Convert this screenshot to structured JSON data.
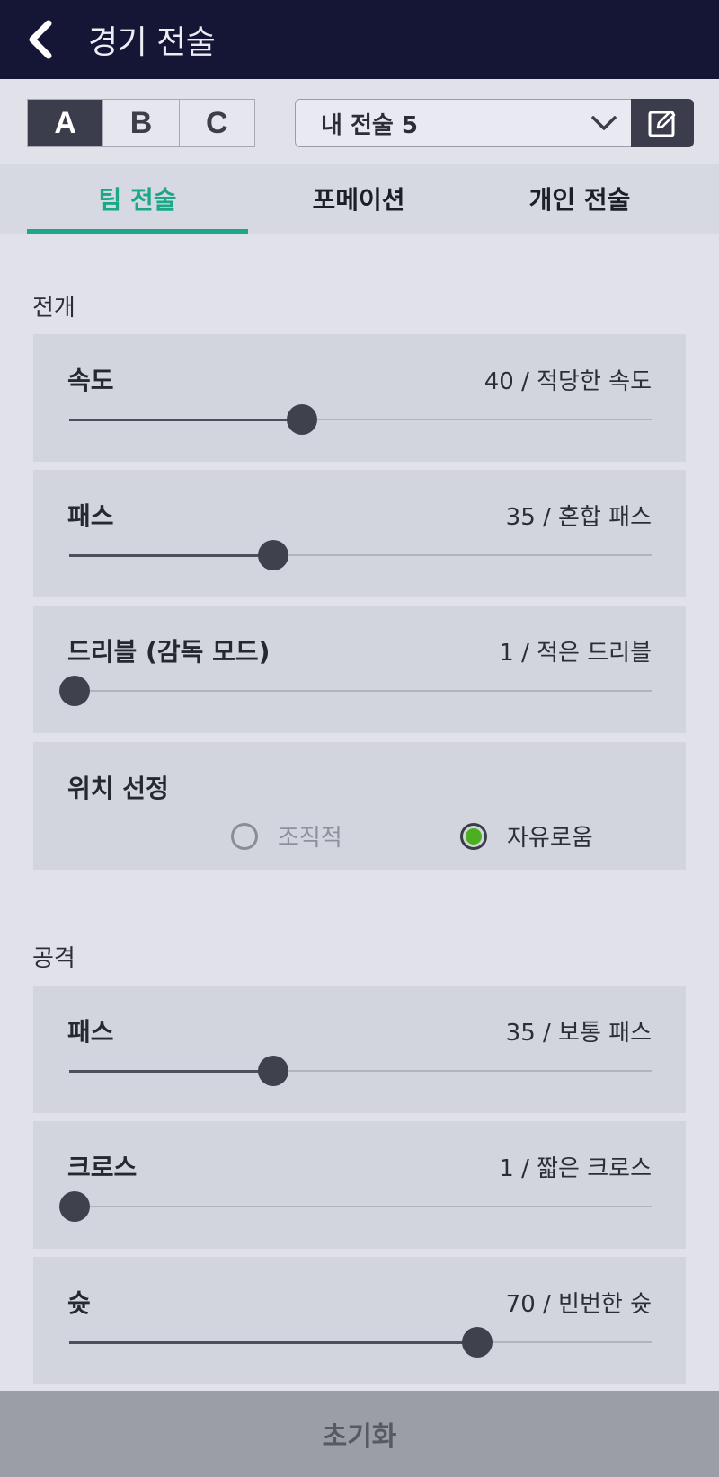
{
  "header": {
    "title": "경기 전술"
  },
  "preset_selector": {
    "segments": [
      "A",
      "B",
      "C"
    ],
    "active_segment": "A",
    "preset_name": "내 전술 5"
  },
  "tabs": [
    {
      "label": "팀 전술",
      "active": true
    },
    {
      "label": "포메이션",
      "active": false
    },
    {
      "label": "개인 전술",
      "active": false
    }
  ],
  "sections": {
    "buildup": {
      "title": "전개",
      "speed": {
        "label": "속도",
        "value_text": "40 / 적당한 속도",
        "value": 40
      },
      "passing": {
        "label": "패스",
        "value_text": "35 / 혼합 패스",
        "value": 35
      },
      "dribbling": {
        "label": "드리블 (감독 모드)",
        "value_text": "1 / 적은 드리블",
        "value": 1
      },
      "positioning": {
        "label": "위치 선정",
        "options": [
          "조직적",
          "자유로움"
        ],
        "selected": "자유로움"
      }
    },
    "attack": {
      "title": "공격",
      "passing": {
        "label": "패스",
        "value_text": "35 / 보통 패스",
        "value": 35
      },
      "crossing": {
        "label": "크로스",
        "value_text": "1 / 짧은 크로스",
        "value": 1
      },
      "shooting": {
        "label": "슛",
        "value_text": "70 / 빈번한 슛",
        "value": 70
      }
    }
  },
  "footer": {
    "reset_label": "초기화"
  },
  "colors": {
    "accent": "#1aa889",
    "header_bg": "#151535",
    "radio_on": "#4caf20"
  },
  "icons": {
    "back": "chevron-left-icon",
    "dropdown": "chevron-down-icon",
    "edit": "edit-icon"
  }
}
